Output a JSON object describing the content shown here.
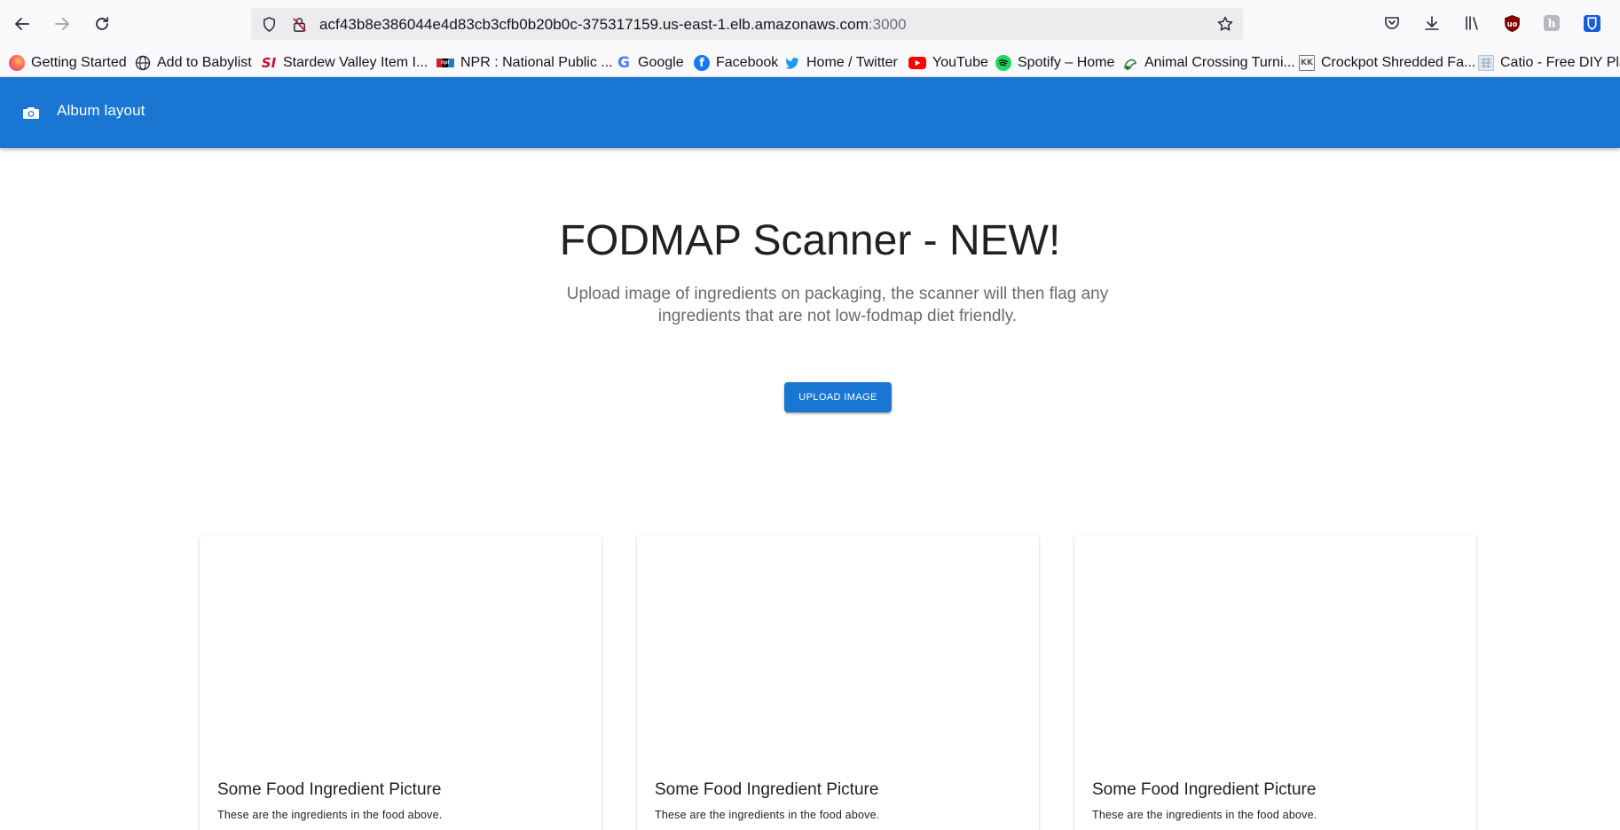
{
  "browser": {
    "url_main": "acf43b8e386044e4d83cb3cfb0b20b0c-375317159.us-east-1.elb.amazonaws.com",
    "url_port": ":3000",
    "bookmarks": [
      {
        "label": "Getting Started",
        "icon": "firefox-icon"
      },
      {
        "label": "Add to Babylist",
        "icon": "globe-icon"
      },
      {
        "label": "Stardew Valley Item I...",
        "icon": "si-icon"
      },
      {
        "label": "NPR : National Public ...",
        "icon": "npr-icon"
      },
      {
        "label": "Google",
        "icon": "google-icon"
      },
      {
        "label": "Facebook",
        "icon": "facebook-icon"
      },
      {
        "label": "Home / Twitter",
        "icon": "twitter-icon"
      },
      {
        "label": "YouTube",
        "icon": "youtube-icon"
      },
      {
        "label": "Spotify – Home",
        "icon": "spotify-icon"
      },
      {
        "label": "Animal Crossing Turni...",
        "icon": "turnip-icon"
      },
      {
        "label": "Crockpot Shredded Fa...",
        "icon": "recipe-icon"
      },
      {
        "label": "Catio - Free DIY Plan",
        "icon": "plan-icon"
      }
    ]
  },
  "appbar": {
    "title": "Album layout"
  },
  "hero": {
    "title": "FODMAP Scanner - NEW!",
    "subtitle": "Upload image of ingredients on packaging, the scanner will then flag any ingredients that are not low-fodmap diet friendly.",
    "button_label": "Upload Image"
  },
  "cards": [
    {
      "title": "Some Food Ingredient Picture",
      "text": "These are the ingredients in the food above."
    },
    {
      "title": "Some Food Ingredient Picture",
      "text": "These are the ingredients in the food above."
    },
    {
      "title": "Some Food Ingredient Picture",
      "text": "These are the ingredients in the food above."
    }
  ],
  "colors": {
    "primary": "#1976d2",
    "toolbar_bg": "#f9f9fb"
  }
}
